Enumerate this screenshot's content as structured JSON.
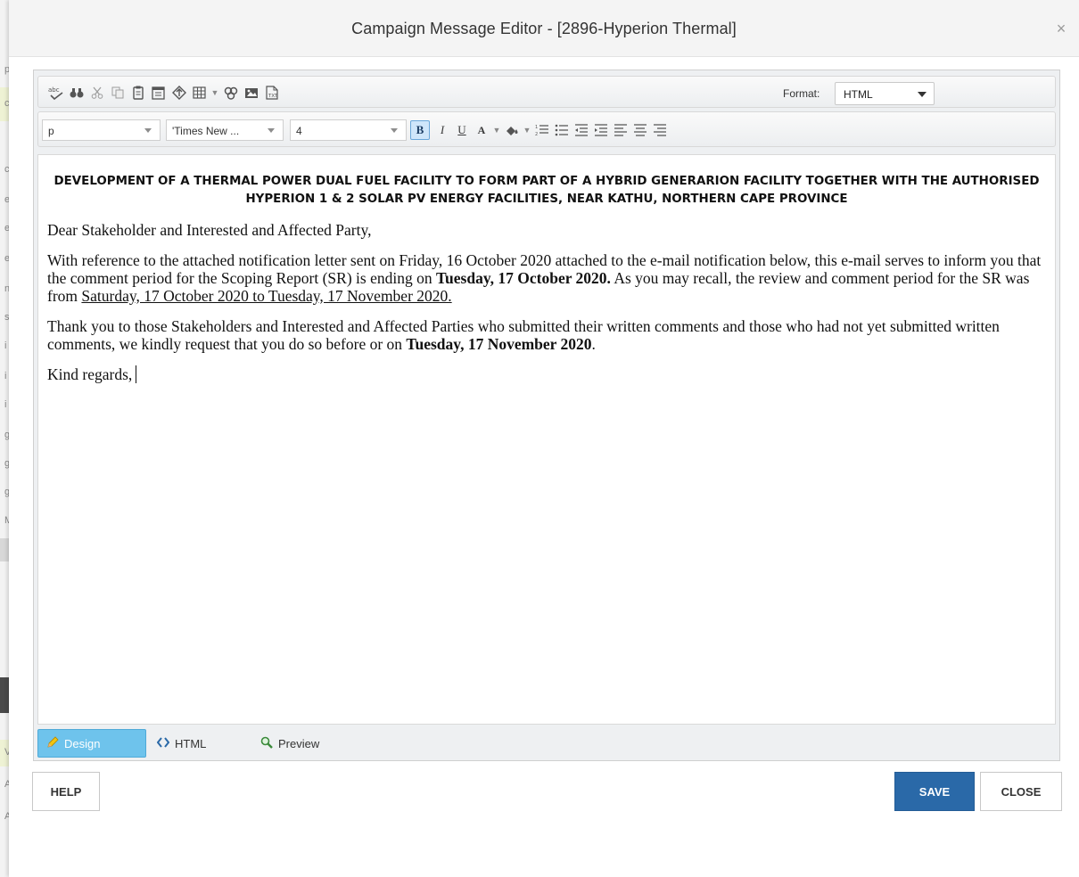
{
  "background_page": {
    "side_letters": [
      "p",
      "ct",
      "c",
      "e",
      "e",
      "e",
      "n",
      "s",
      "i",
      "i",
      "i",
      "g",
      "g",
      "g",
      "M",
      "V",
      "A",
      "A"
    ]
  },
  "dialog": {
    "title": "Campaign Message Editor - [2896-Hyperion Thermal]",
    "close_symbol": "×"
  },
  "toolbar": {
    "format_label": "Format:",
    "format_value": "HTML",
    "block_format": "p",
    "font_family": "'Times New ...",
    "font_size": "4"
  },
  "document": {
    "heading": "DEVELOPMENT  OF A THERMAL POWER DUAL FUEL FACILITY TO FORM PART OF A HYBRID GENERARION FACILITY TOGETHER WITH THE AUTHORISED HYPERION 1 & 2 SOLAR PV ENERGY FACILITIES, NEAR KATHU, NORTHERN CAPE PROVINCE",
    "salutation": "Dear Stakeholder and Interested and Affected Party,",
    "p1_a": "With reference to the attached notification letter sent on Friday, 16 October 2020 attached to the e-mail notification below, this e-mail serves to inform you that the comment period for the Scoping Report (SR) is ending on ",
    "p1_bold": "Tuesday, 17 October 2020.",
    "p1_b": "  As you may recall, the review and comment period for the SR was from ",
    "p1_underline": "Saturday, 17 October 2020 to Tuesday, 17 November 2020.",
    "p2_a": "Thank you to those Stakeholders and Interested and Affected Parties who submitted their written comments and those who had not yet submitted written comments, we kindly request that you do so before or on ",
    "p2_bold": "Tuesday, 17 November 2020",
    "p2_b": ".",
    "closing": "Kind regards,"
  },
  "modes": {
    "design": "Design",
    "html": "HTML",
    "preview": "Preview",
    "active": "Design"
  },
  "buttons": {
    "help": "HELP",
    "save": "SAVE",
    "close": "CLOSE"
  },
  "colors": {
    "save_bg": "#2a69a8",
    "design_tab_bg": "#6ec3ec",
    "bold_active_bg": "#cfe6fa"
  }
}
